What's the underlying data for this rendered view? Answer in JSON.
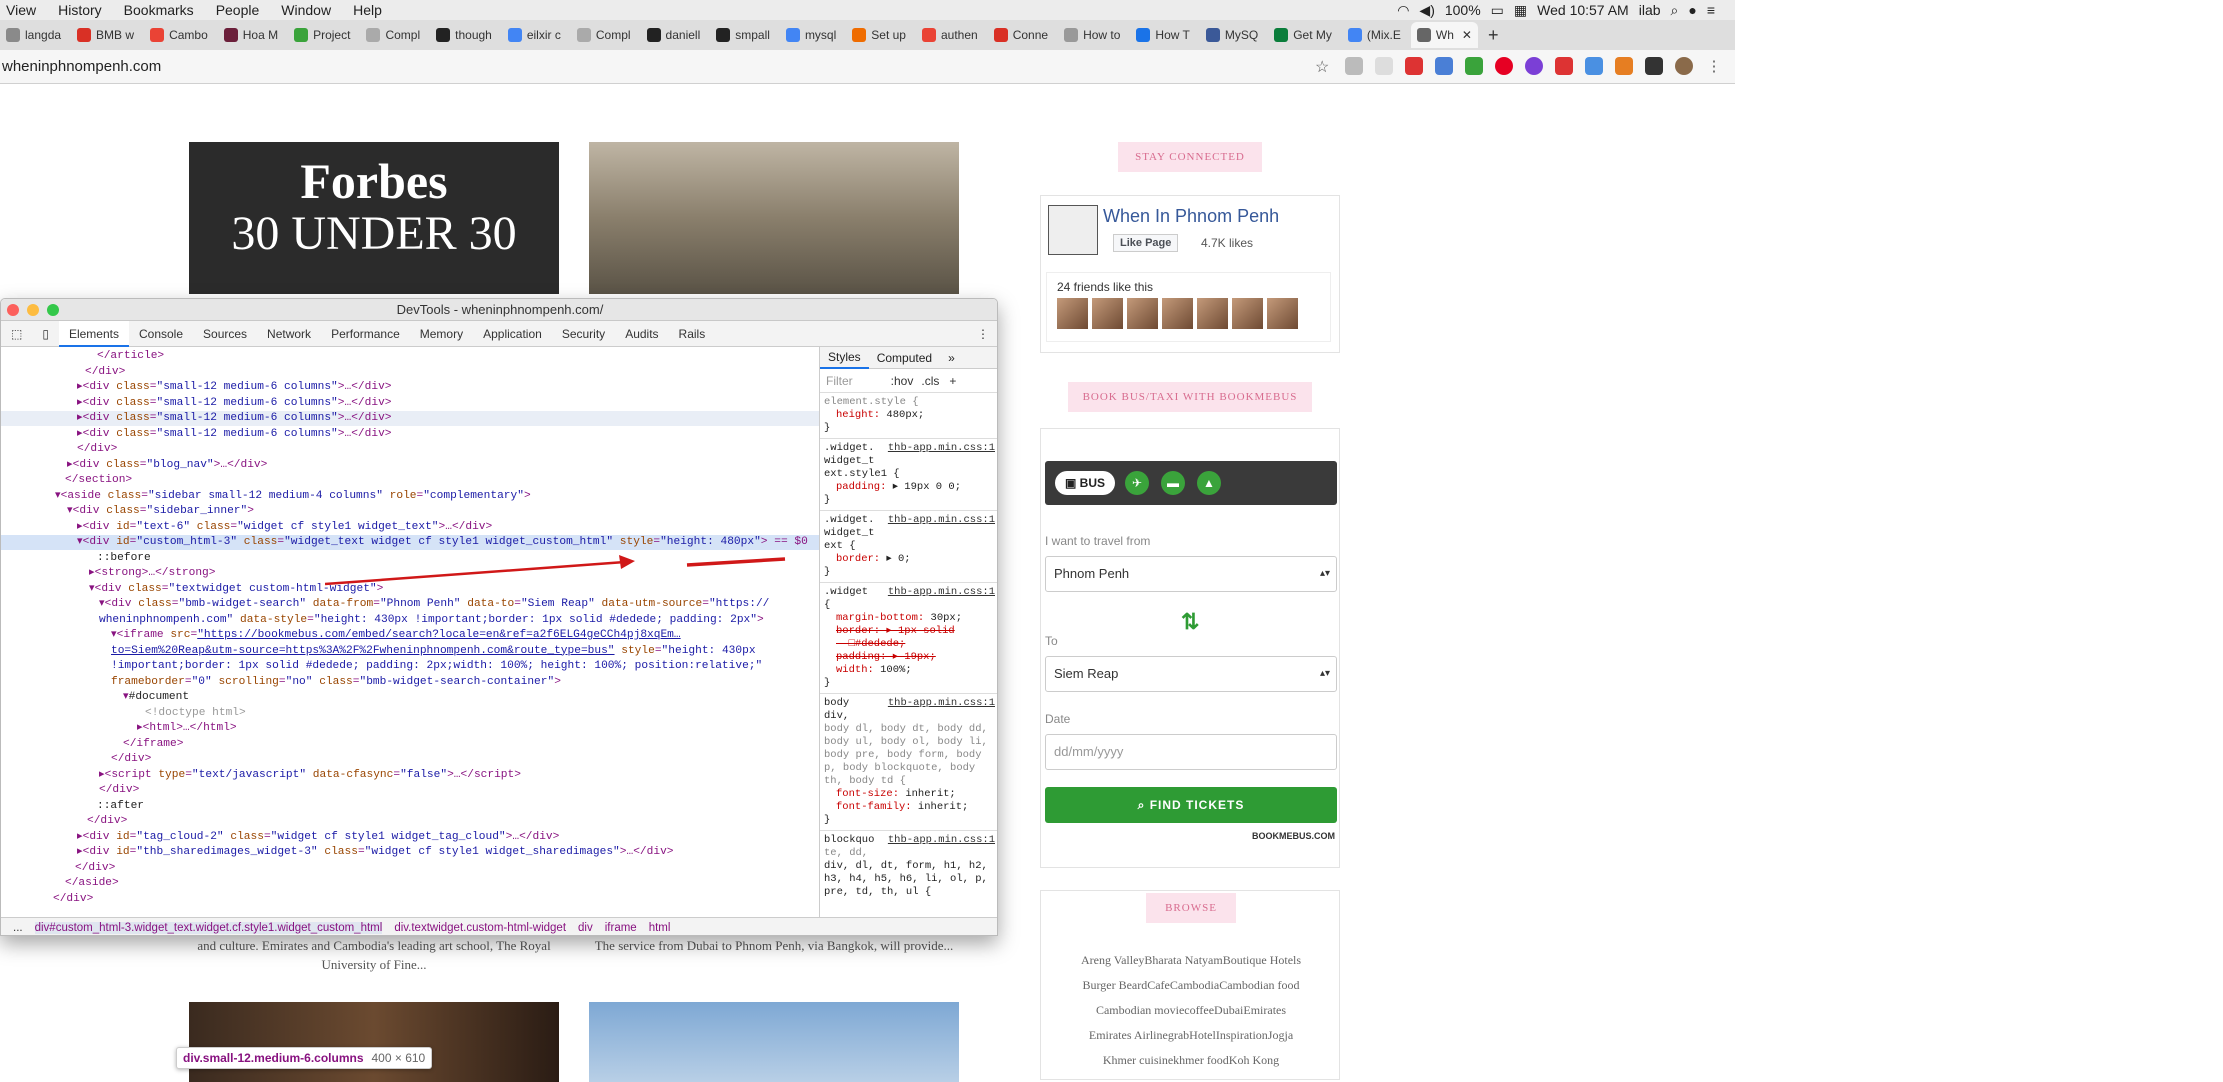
{
  "menubar": {
    "items": [
      "View",
      "History",
      "Bookmarks",
      "People",
      "Window",
      "Help"
    ],
    "battery": "100%",
    "clock": "Wed 10:57 AM",
    "user": "ilab"
  },
  "tabs": [
    {
      "label": "langda",
      "color": "#8a8a8a"
    },
    {
      "label": "BMB w",
      "color": "#d93025"
    },
    {
      "label": "Cambo",
      "color": "#ea4335"
    },
    {
      "label": "Hoa M",
      "color": "#6b1f3a"
    },
    {
      "label": "Project",
      "color": "#3aa33b"
    },
    {
      "label": "Compl",
      "color": "#aaaaaa"
    },
    {
      "label": "though",
      "color": "#222222"
    },
    {
      "label": "eilxir c",
      "color": "#4285f4"
    },
    {
      "label": "Compl",
      "color": "#aaaaaa"
    },
    {
      "label": "daniell",
      "color": "#222222"
    },
    {
      "label": "smpall",
      "color": "#222222"
    },
    {
      "label": "mysql",
      "color": "#4285f4"
    },
    {
      "label": "Set up",
      "color": "#ef6c00"
    },
    {
      "label": "authen",
      "color": "#ea4335"
    },
    {
      "label": "Conne",
      "color": "#d93025"
    },
    {
      "label": "How to",
      "color": "#999999"
    },
    {
      "label": "How T",
      "color": "#1a73e8"
    },
    {
      "label": "MySQ",
      "color": "#3b5998"
    },
    {
      "label": "Get My",
      "color": "#0a7d3b"
    },
    {
      "label": "(Mix.E",
      "color": "#4285f4"
    },
    {
      "label": "Wh",
      "color": "#666666"
    }
  ],
  "address": {
    "url": "wheninphnompenh.com"
  },
  "page": {
    "forbes_line1": "Forbes",
    "forbes_line2": "30 UNDER 30",
    "caption_left": "and culture. Emirates and Cambodia's leading art school, The Royal University of Fine...",
    "caption_right": "The service from Dubai to Phnom Penh, via Bangkok, will provide..."
  },
  "sidebar": {
    "stay_connected": "STAY CONNECTED",
    "fb_name": "When In Phnom Penh",
    "fb_like": "Like Page",
    "fb_likes": "4.7K likes",
    "fb_friends": "24 friends like this",
    "book_title": "BOOK BUS/TAXI WITH BOOKMEBUS",
    "bus_label": "BUS",
    "from_label": "I want to travel from",
    "from_value": "Phnom Penh",
    "to_label": "To",
    "to_value": "Siem Reap",
    "date_label": "Date",
    "date_placeholder": "dd/mm/yyyy",
    "find_button": "FIND TICKETS",
    "powered": "BOOKMEBUS.COM",
    "browse_title": "BROWSE",
    "tags": [
      "Areng ValleyBharata NatyamBoutique Hotels",
      "Burger BeardCafeCambodiaCambodian food",
      "Cambodian moviecoffeeDubaiEmirates",
      "Emirates AirlinegrabHotelInspirationJogja",
      "Khmer cuisinekhmer foodKoh Kong"
    ]
  },
  "devtools": {
    "title": "DevTools - wheninphnompenh.com/",
    "tabs": [
      "Elements",
      "Console",
      "Sources",
      "Network",
      "Performance",
      "Memory",
      "Application",
      "Security",
      "Audits",
      "Rails"
    ],
    "styles_tabs": [
      "Styles",
      "Computed"
    ],
    "filter_placeholder": "Filter",
    "hov": ":hov",
    "cls": ".cls",
    "crumbs": [
      "div#custom_html-3.widget_text.widget.cf.style1.widget_custom_html",
      "div.textwidget.custom-html-widget",
      "div",
      "iframe",
      "html"
    ],
    "tooltip_name": "div.small-12.medium-6.columns",
    "tooltip_dims": "400 × 610"
  }
}
